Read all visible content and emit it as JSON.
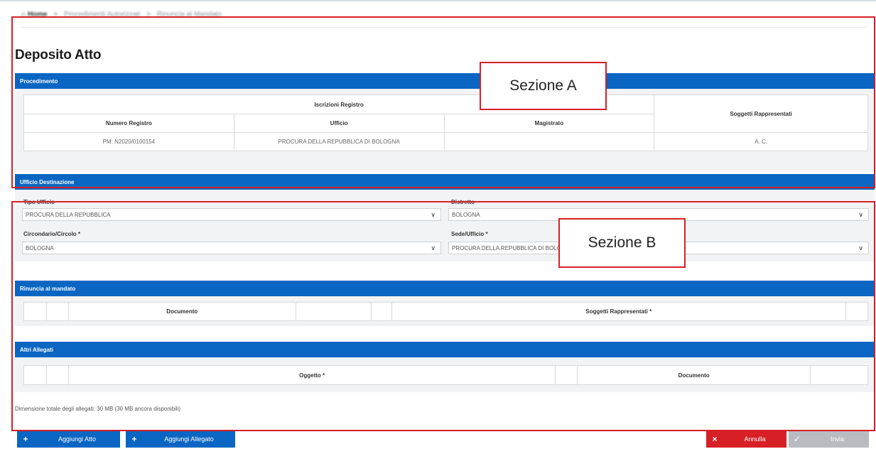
{
  "breadcrumb": {
    "home": "Home",
    "crumb2": "Procedimenti Autorizzati",
    "crumb3": "Rinuncia al Mandato"
  },
  "page_title": "Deposito Atto",
  "procedimento": {
    "header": "Procedimento",
    "group_header": "Iscrizioni Registro",
    "columns": [
      "Numero Registro",
      "Ufficio",
      "Magistrato",
      "Soggetti Rappresentati"
    ],
    "row": {
      "numero": "PM: N2020/0100154",
      "ufficio": "PROCURA DELLA REPUBBLICA DI BOLOGNA",
      "magistrato": "",
      "soggetti": "A. C."
    }
  },
  "ufficio": {
    "header": "Ufficio Destinazione",
    "tipo_label": "Tipo Ufficio",
    "tipo_value": "PROCURA DELLA REPUBBLICA",
    "distretto_label": "Distretto",
    "distretto_value": "BOLOGNA",
    "circondario_label": "Circondario/Circolo *",
    "circondario_value": "BOLOGNA",
    "sede_label": "Sede/Ufficio *",
    "sede_value": "PROCURA DELLA REPUBBLICA DI BOLOGNA"
  },
  "rinuncia": {
    "header": "Rinuncia al mandato",
    "col_documento": "Documento",
    "col_soggetti": "Soggetti Rappresentati *"
  },
  "allegati": {
    "header": "Altri Allegati",
    "col_oggetto": "Oggetto *",
    "col_documento": "Documento"
  },
  "note": "Dimensione totale degli allegati: 30 MB (30 MB ancora disponibili)",
  "buttons": {
    "aggiungi_atto": "Aggiungi Atto",
    "aggiungi_allegato": "Aggiungi Allegato",
    "annulla": "Annulla",
    "invia": "Invia"
  },
  "callouts": {
    "a": "Sezione A",
    "b": "Sezione B"
  },
  "icons": {
    "plus": "+",
    "close": "×",
    "check": "✓",
    "chevron": "∨",
    "arrow": "›"
  },
  "colors": {
    "primary": "#0a66c2",
    "danger": "#d71f26",
    "disabled": "#b8bcc1"
  }
}
